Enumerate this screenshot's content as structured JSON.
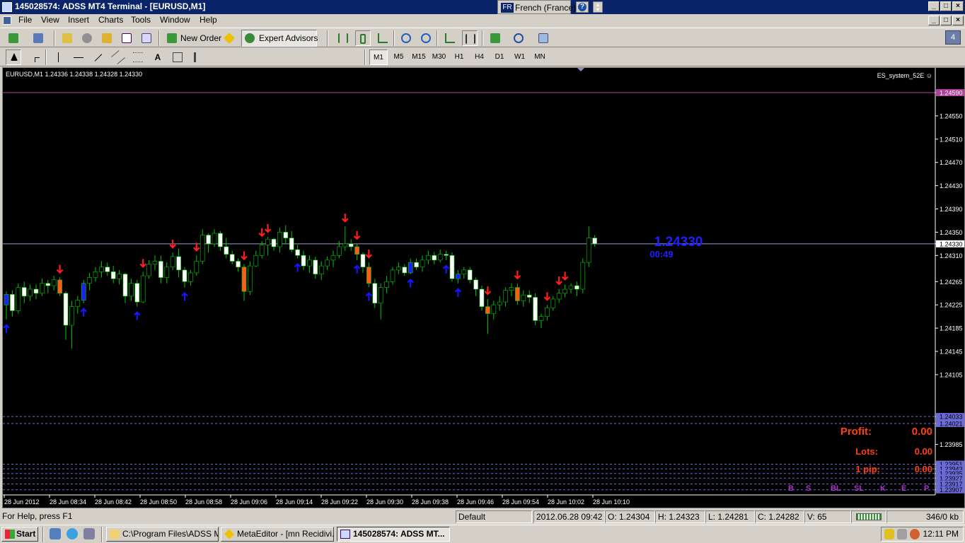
{
  "window": {
    "title": "145028574: ADSS MT4 Terminal - [EURUSD,M1]",
    "lang_code": "FR",
    "lang_name": "French (France)",
    "help_glyph": "?",
    "buttons": {
      "minimize": "_",
      "restore": "□",
      "close": "×"
    }
  },
  "menu": {
    "file": "File",
    "view": "View",
    "insert": "Insert",
    "charts": "Charts",
    "tools": "Tools",
    "window": "Window",
    "help": "Help"
  },
  "toolbar": {
    "new_order": "New Order",
    "expert_advisors": "Expert Advisors",
    "timeframes": [
      "M1",
      "M5",
      "M15",
      "M30",
      "H1",
      "H4",
      "D1",
      "W1",
      "MN"
    ],
    "active_timeframe": "M1",
    "chart_window_count": "4"
  },
  "chart_data": {
    "type": "candlestick",
    "symbol_info": "EURUSD,M1  1.24336 1.24338 1.24328 1.24330",
    "expert_name": "ES_system_52E ☺",
    "price_axis": [
      "1.24590",
      "1.24550",
      "1.24510",
      "1.24470",
      "1.24430",
      "1.24390",
      "1.24350",
      "1.24330",
      "1.24310",
      "1.24265",
      "1.24225",
      "1.24185",
      "1.24145",
      "1.24105",
      "1.24033",
      "1.24021",
      "1.23985",
      "1.23951",
      "1.23943",
      "1.23935",
      "1.23927",
      "1.23917",
      "1.23907"
    ],
    "ylim": [
      1.239,
      1.246
    ],
    "time_axis": [
      "28 Jun 2012",
      "28 Jun 08:34",
      "28 Jun 08:42",
      "28 Jun 08:50",
      "28 Jun 08:58",
      "28 Jun 09:06",
      "28 Jun 09:14",
      "28 Jun 09:22",
      "28 Jun 09:30",
      "28 Jun 09:38",
      "28 Jun 09:46",
      "28 Jun 09:54",
      "28 Jun 10:02",
      "28 Jun 10:10"
    ],
    "horizontal_levels": [
      {
        "price": 1.2459,
        "color": "#b0409a",
        "style": "solid"
      },
      {
        "price": 1.2433,
        "color": "#9b9bd0",
        "style": "solid"
      },
      {
        "price": 1.24033,
        "color": "#6b6bd8",
        "style": "dashed"
      },
      {
        "price": 1.24021,
        "color": "#6b6bd8",
        "style": "dashed"
      },
      {
        "price": 1.23951,
        "color": "#6b6bd8",
        "style": "dashed"
      },
      {
        "price": 1.23943,
        "color": "#6b6bd8",
        "style": "dashed"
      },
      {
        "price": 1.23935,
        "color": "#6b6bd8",
        "style": "dashed"
      },
      {
        "price": 1.23927,
        "color": "#6b6bd8",
        "style": "dashed"
      },
      {
        "price": 1.23917,
        "color": "#6b6bd8",
        "style": "dashed"
      },
      {
        "price": 1.23907,
        "color": "#6b6bd8",
        "style": "dashed"
      }
    ],
    "candles": [
      [
        1.24225,
        1.24248,
        1.242,
        1.24243
      ],
      [
        1.24243,
        1.2425,
        1.24205,
        1.24215
      ],
      [
        1.24215,
        1.24262,
        1.2421,
        1.24255
      ],
      [
        1.24255,
        1.24265,
        1.24228,
        1.2424
      ],
      [
        1.2424,
        1.2426,
        1.24232,
        1.24252
      ],
      [
        1.24252,
        1.2426,
        1.24235,
        1.24245
      ],
      [
        1.24245,
        1.2427,
        1.2424,
        1.24262
      ],
      [
        1.24262,
        1.24268,
        1.24245,
        1.24258
      ],
      [
        1.24258,
        1.24275,
        1.2425,
        1.24268
      ],
      [
        1.24268,
        1.24272,
        1.2424,
        1.24245
      ],
      [
        1.24245,
        1.24248,
        1.24165,
        1.2419
      ],
      [
        1.2419,
        1.24232,
        1.2415,
        1.24222
      ],
      [
        1.24222,
        1.2424,
        1.2421,
        1.24233
      ],
      [
        1.24233,
        1.24268,
        1.24228,
        1.24262
      ],
      [
        1.24262,
        1.2428,
        1.2425,
        1.24272
      ],
      [
        1.24272,
        1.2429,
        1.24265,
        1.24282
      ],
      [
        1.24282,
        1.243,
        1.24272,
        1.2429
      ],
      [
        1.2429,
        1.24298,
        1.24275,
        1.24282
      ],
      [
        1.24282,
        1.24292,
        1.24262,
        1.2427
      ],
      [
        1.2427,
        1.24285,
        1.2426,
        1.24278
      ],
      [
        1.24278,
        1.2428,
        1.24228,
        1.2424
      ],
      [
        1.2424,
        1.2427,
        1.24232,
        1.24262
      ],
      [
        1.24262,
        1.24268,
        1.24222,
        1.2423
      ],
      [
        1.2423,
        1.24282,
        1.24228,
        1.24275
      ],
      [
        1.24275,
        1.24302,
        1.2427,
        1.24295
      ],
      [
        1.24295,
        1.2431,
        1.24285,
        1.243
      ],
      [
        1.243,
        1.2431,
        1.24262,
        1.24272
      ],
      [
        1.24272,
        1.24298,
        1.24262,
        1.2429
      ],
      [
        1.2429,
        1.24315,
        1.24285,
        1.24308
      ],
      [
        1.24308,
        1.24322,
        1.24272,
        1.24285
      ],
      [
        1.24285,
        1.2429,
        1.24255,
        1.24265
      ],
      [
        1.24265,
        1.24285,
        1.24258,
        1.2428
      ],
      [
        1.2428,
        1.2431,
        1.24275,
        1.243
      ],
      [
        1.243,
        1.24355,
        1.24295,
        1.24345
      ],
      [
        1.24345,
        1.24348,
        1.24315,
        1.2433
      ],
      [
        1.2433,
        1.24355,
        1.24325,
        1.24348
      ],
      [
        1.24348,
        1.24352,
        1.24318,
        1.24325
      ],
      [
        1.24325,
        1.2434,
        1.24305,
        1.24312
      ],
      [
        1.24312,
        1.24318,
        1.24295,
        1.243
      ],
      [
        1.243,
        1.24305,
        1.24282,
        1.2429
      ],
      [
        1.2429,
        1.24295,
        1.24232,
        1.24248
      ],
      [
        1.24248,
        1.243,
        1.24242,
        1.24292
      ],
      [
        1.24292,
        1.24318,
        1.2429,
        1.2431
      ],
      [
        1.2431,
        1.24335,
        1.24305,
        1.24328
      ],
      [
        1.24328,
        1.24342,
        1.2431,
        1.24338
      ],
      [
        1.24338,
        1.2434,
        1.24318,
        1.24325
      ],
      [
        1.24325,
        1.24358,
        1.24315,
        1.2435
      ],
      [
        1.2435,
        1.24362,
        1.2433,
        1.2434
      ],
      [
        1.2434,
        1.24352,
        1.24315,
        1.2432
      ],
      [
        1.2432,
        1.24328,
        1.24305,
        1.2431
      ],
      [
        1.2431,
        1.24318,
        1.24285,
        1.24292
      ],
      [
        1.24292,
        1.2431,
        1.2428,
        1.24302
      ],
      [
        1.24302,
        1.24308,
        1.2427,
        1.24278
      ],
      [
        1.24278,
        1.243,
        1.24268,
        1.24292
      ],
      [
        1.24292,
        1.24308,
        1.24285,
        1.24302
      ],
      [
        1.24302,
        1.24318,
        1.2429,
        1.2431
      ],
      [
        1.2431,
        1.24335,
        1.24305,
        1.24325
      ],
      [
        1.24325,
        1.2436,
        1.24318,
        1.2433
      ],
      [
        1.2433,
        1.24338,
        1.24318,
        1.24325
      ],
      [
        1.24325,
        1.2433,
        1.24302,
        1.24312
      ],
      [
        1.24312,
        1.24315,
        1.2428,
        1.2429
      ],
      [
        1.2429,
        1.24298,
        1.24255,
        1.24262
      ],
      [
        1.24262,
        1.2427,
        1.2422,
        1.24228
      ],
      [
        1.24228,
        1.24262,
        1.242,
        1.24255
      ],
      [
        1.24255,
        1.24275,
        1.24245,
        1.24265
      ],
      [
        1.24265,
        1.2429,
        1.2426,
        1.24285
      ],
      [
        1.24285,
        1.24298,
        1.24278,
        1.2429
      ],
      [
        1.2429,
        1.24295,
        1.24275,
        1.2428
      ],
      [
        1.2428,
        1.24305,
        1.24278,
        1.24298
      ],
      [
        1.24298,
        1.24305,
        1.24285,
        1.2429
      ],
      [
        1.2429,
        1.2431,
        1.24282,
        1.24302
      ],
      [
        1.24302,
        1.24318,
        1.24295,
        1.2431
      ],
      [
        1.2431,
        1.24316,
        1.24295,
        1.24302
      ],
      [
        1.24302,
        1.2432,
        1.24298,
        1.24312
      ],
      [
        1.24312,
        1.24318,
        1.24302,
        1.2431
      ],
      [
        1.2431,
        1.24315,
        1.24265,
        1.2427
      ],
      [
        1.2427,
        1.24285,
        1.24262,
        1.24278
      ],
      [
        1.24278,
        1.2429,
        1.2427,
        1.24285
      ],
      [
        1.24285,
        1.2429,
        1.24262,
        1.24268
      ],
      [
        1.24268,
        1.24272,
        1.2424,
        1.24252
      ],
      [
        1.24252,
        1.24258,
        1.24215,
        1.24222
      ],
      [
        1.24222,
        1.24235,
        1.24175,
        1.2421
      ],
      [
        1.2421,
        1.24232,
        1.242,
        1.24225
      ],
      [
        1.24225,
        1.2424,
        1.24215,
        1.2423
      ],
      [
        1.2423,
        1.24255,
        1.24222,
        1.2425
      ],
      [
        1.2425,
        1.24262,
        1.2424,
        1.24255
      ],
      [
        1.24255,
        1.24262,
        1.24225,
        1.24232
      ],
      [
        1.24232,
        1.2425,
        1.24222,
        1.24242
      ],
      [
        1.24242,
        1.2425,
        1.24228,
        1.24238
      ],
      [
        1.24238,
        1.24245,
        1.2419,
        1.24198
      ],
      [
        1.24198,
        1.2421,
        1.24185,
        1.24205
      ],
      [
        1.24205,
        1.24225,
        1.24198,
        1.2422
      ],
      [
        1.2422,
        1.2424,
        1.24215,
        1.24235
      ],
      [
        1.24235,
        1.24252,
        1.24228,
        1.24245
      ],
      [
        1.24245,
        1.2426,
        1.24238,
        1.24252
      ],
      [
        1.24252,
        1.24262,
        1.24245,
        1.24258
      ],
      [
        1.24258,
        1.24265,
        1.2424,
        1.24252
      ],
      [
        1.24252,
        1.24305,
        1.24245,
        1.24298
      ],
      [
        1.24298,
        1.2436,
        1.2429,
        1.2434
      ],
      [
        1.2434,
        1.24345,
        1.24325,
        1.2433
      ]
    ],
    "signals": [
      {
        "index": 0,
        "dir": "buy",
        "color": "#1515ff"
      },
      {
        "index": 9,
        "dir": "sell",
        "color": "#ff1e1e"
      },
      {
        "index": 13,
        "dir": "buy",
        "color": "#1515ff"
      },
      {
        "index": 22,
        "dir": "buy",
        "color": "#1515ff"
      },
      {
        "index": 23,
        "dir": "sell",
        "color": "#ff1e1e"
      },
      {
        "index": 28,
        "dir": "sell",
        "color": "#ff1e1e"
      },
      {
        "index": 30,
        "dir": "buy",
        "color": "#1515ff"
      },
      {
        "index": 32,
        "dir": "sell",
        "color": "#ff1e1e"
      },
      {
        "index": 40,
        "dir": "sell",
        "color": "#ff1e1e"
      },
      {
        "index": 43,
        "dir": "sell",
        "color": "#ff1e1e"
      },
      {
        "index": 44,
        "dir": "sell",
        "color": "#ff1e1e"
      },
      {
        "index": 49,
        "dir": "buy",
        "color": "#1515ff"
      },
      {
        "index": 57,
        "dir": "sell",
        "color": "#ff1e1e"
      },
      {
        "index": 59,
        "dir": "sell",
        "color": "#ff1e1e"
      },
      {
        "index": 59,
        "dir": "buy",
        "color": "#1515ff"
      },
      {
        "index": 61,
        "dir": "sell",
        "color": "#ff1e1e"
      },
      {
        "index": 61,
        "dir": "buy",
        "color": "#1515ff"
      },
      {
        "index": 68,
        "dir": "buy",
        "color": "#1515ff"
      },
      {
        "index": 74,
        "dir": "buy",
        "color": "#1515ff"
      },
      {
        "index": 76,
        "dir": "buy",
        "color": "#1515ff"
      },
      {
        "index": 81,
        "dir": "sell",
        "color": "#ff1e1e"
      },
      {
        "index": 86,
        "dir": "sell",
        "color": "#ff1e1e"
      },
      {
        "index": 91,
        "dir": "sell",
        "color": "#ff1e1e"
      },
      {
        "index": 93,
        "dir": "sell",
        "color": "#ff1e1e"
      },
      {
        "index": 94,
        "dir": "sell",
        "color": "#ff1e1e"
      }
    ],
    "colors": {
      "up": "#00c800",
      "down": "#ff5a1e",
      "buy_body": "#1e1eff",
      "bull_body": "#000000",
      "bear_body": "#ffffff"
    },
    "price_label": "1.24330",
    "bar_timer": "00:49",
    "profit_label": "Profit:",
    "profit_value": "0.00",
    "lots_label": "Lots:",
    "lots_value": "0.00",
    "pip_label": "1 pip:",
    "pip_value": "0.00",
    "level_tags": [
      "B",
      "S",
      "BL",
      "SL",
      "K",
      "E",
      "P"
    ]
  },
  "status": {
    "help": "For Help, press F1",
    "profile": "Default",
    "datetime": "2012.06.28 09:42",
    "open": "O: 1.24304",
    "high": "H: 1.24323",
    "low": "L: 1.24281",
    "close": "C: 1.24282",
    "volume": "V: 65",
    "traffic": "346/0 kb"
  },
  "taskbar": {
    "start": "Start",
    "tasks": [
      "C:\\Program Files\\ADSS M...",
      "MetaEditor - [mn Recidivi...",
      "145028574: ADSS MT..."
    ],
    "clock": "12:11 PM"
  }
}
